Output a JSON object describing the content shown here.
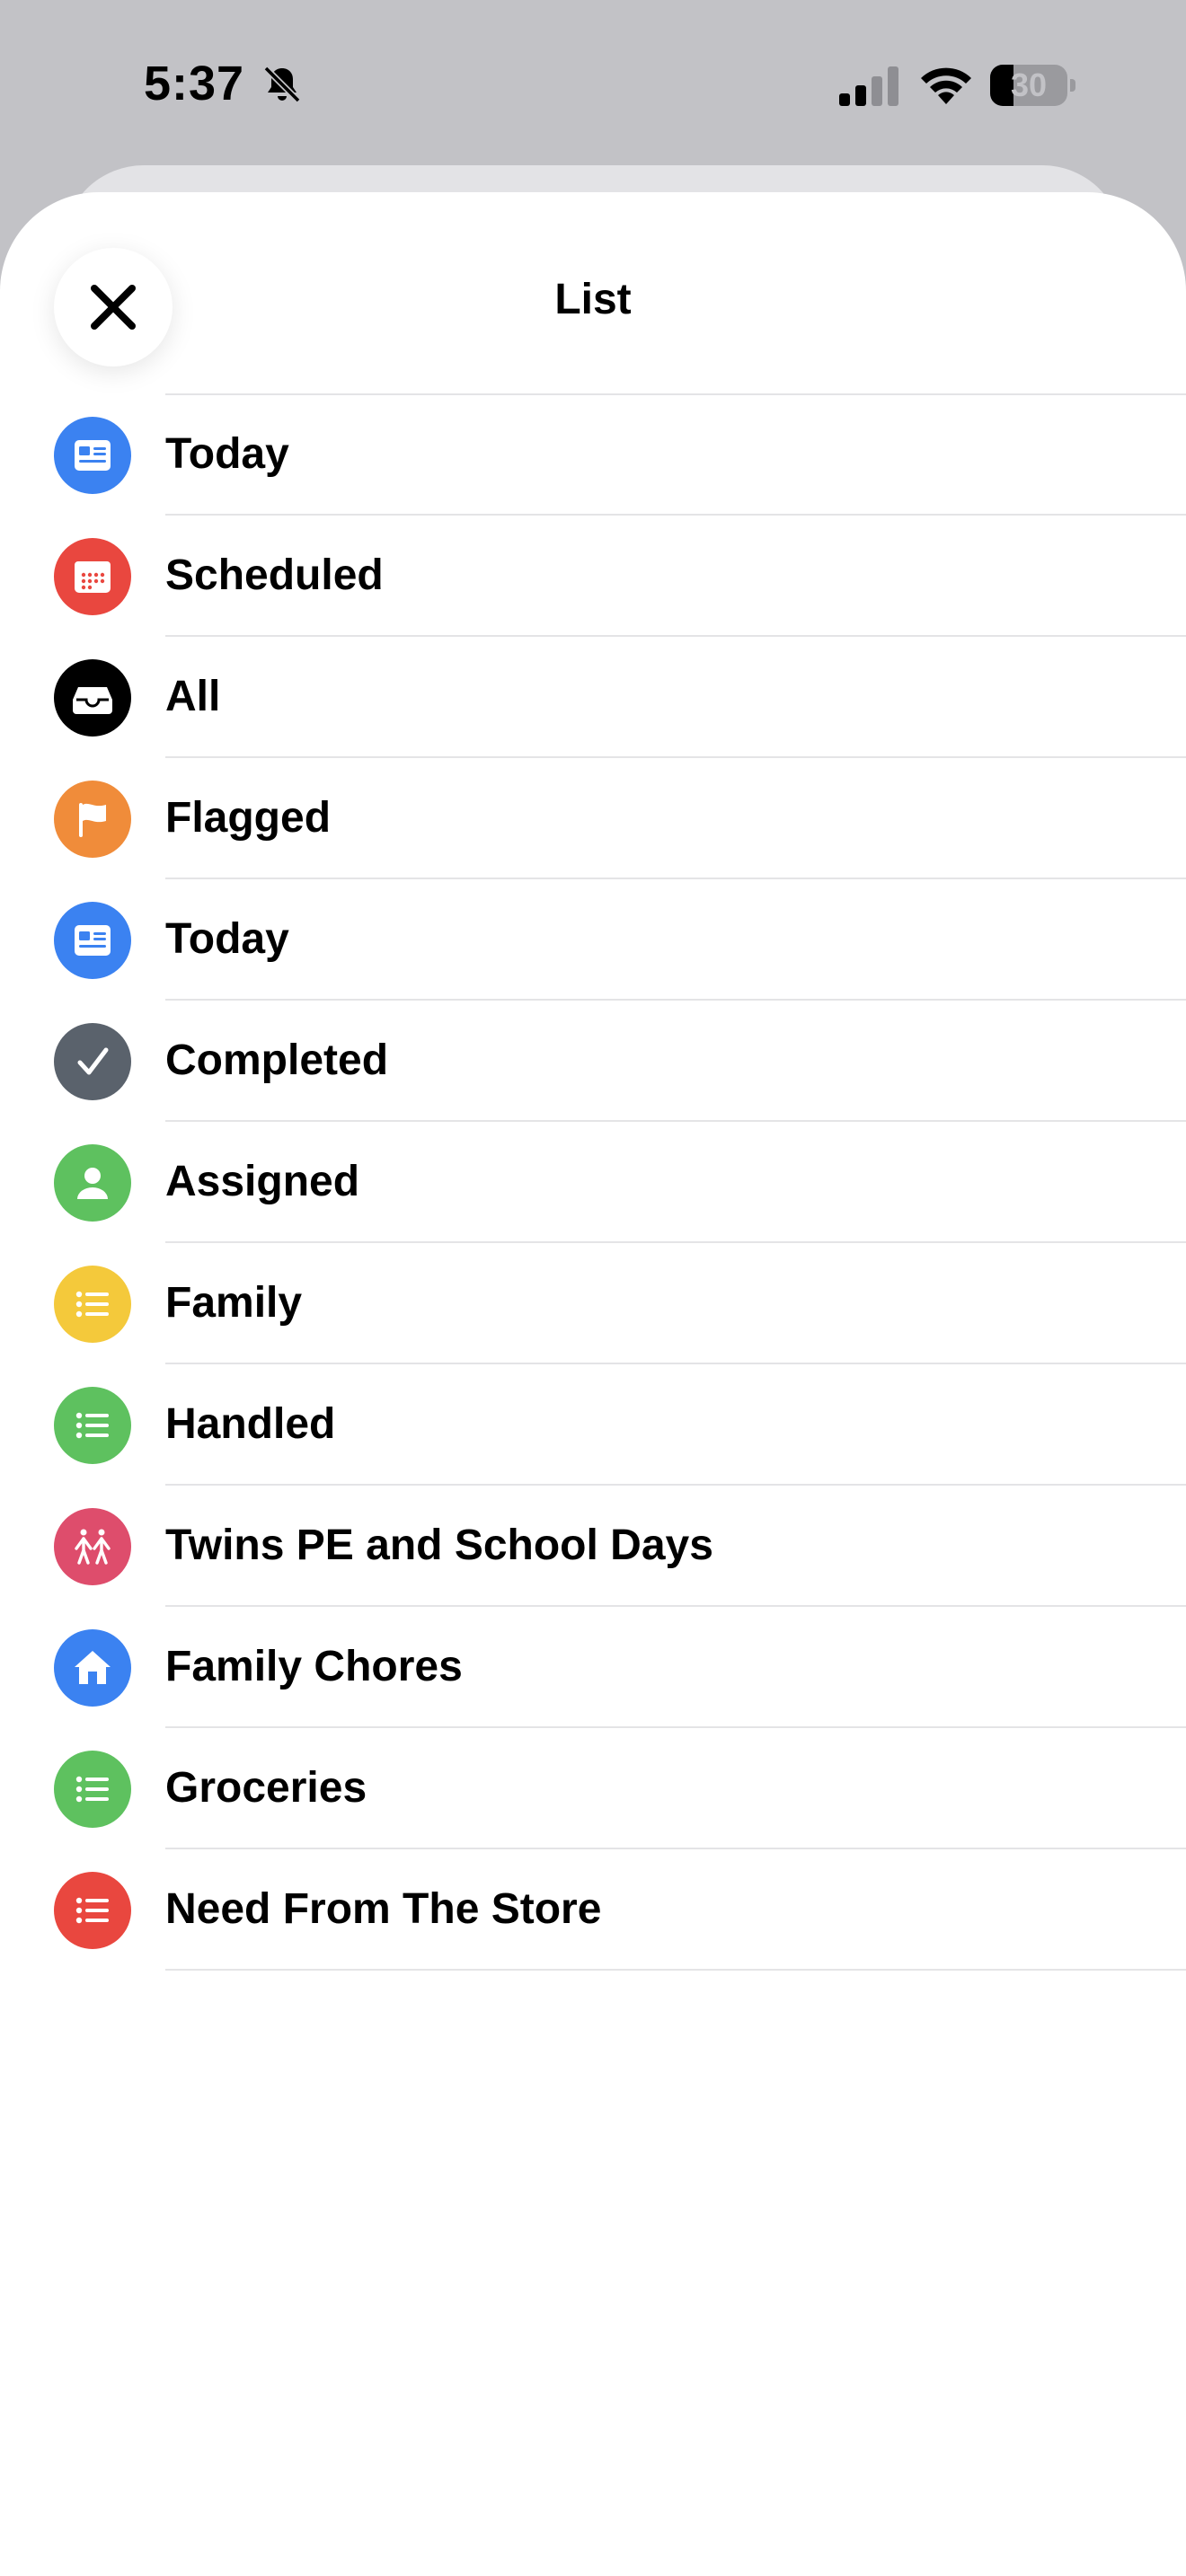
{
  "status_bar": {
    "time": "5:37",
    "battery_level": "30",
    "battery_fraction": 0.3
  },
  "sheet": {
    "title": "List"
  },
  "lists": [
    {
      "label": "Today",
      "icon": "today-icon",
      "color": "#3b82f1"
    },
    {
      "label": "Scheduled",
      "icon": "calendar-icon",
      "color": "#e9473f"
    },
    {
      "label": "All",
      "icon": "tray-icon",
      "color": "#000000"
    },
    {
      "label": "Flagged",
      "icon": "flag-icon",
      "color": "#f08c3a"
    },
    {
      "label": "Today",
      "icon": "today-icon",
      "color": "#3b82f1"
    },
    {
      "label": "Completed",
      "icon": "checkmark-icon",
      "color": "#5a626c"
    },
    {
      "label": "Assigned",
      "icon": "person-icon",
      "color": "#5ec15f"
    },
    {
      "label": "Family",
      "icon": "list-bullet-icon",
      "color": "#f4c93b"
    },
    {
      "label": "Handled",
      "icon": "list-bullet-icon",
      "color": "#5ec15f"
    },
    {
      "label": "Twins PE and School Days",
      "icon": "two-people-icon",
      "color": "#de4d6c"
    },
    {
      "label": "Family Chores",
      "icon": "house-icon",
      "color": "#3b82f1"
    },
    {
      "label": "Groceries",
      "icon": "list-bullet-icon",
      "color": "#5ec15f"
    },
    {
      "label": "Need From The Store",
      "icon": "list-bullet-icon",
      "color": "#e9473f"
    }
  ]
}
